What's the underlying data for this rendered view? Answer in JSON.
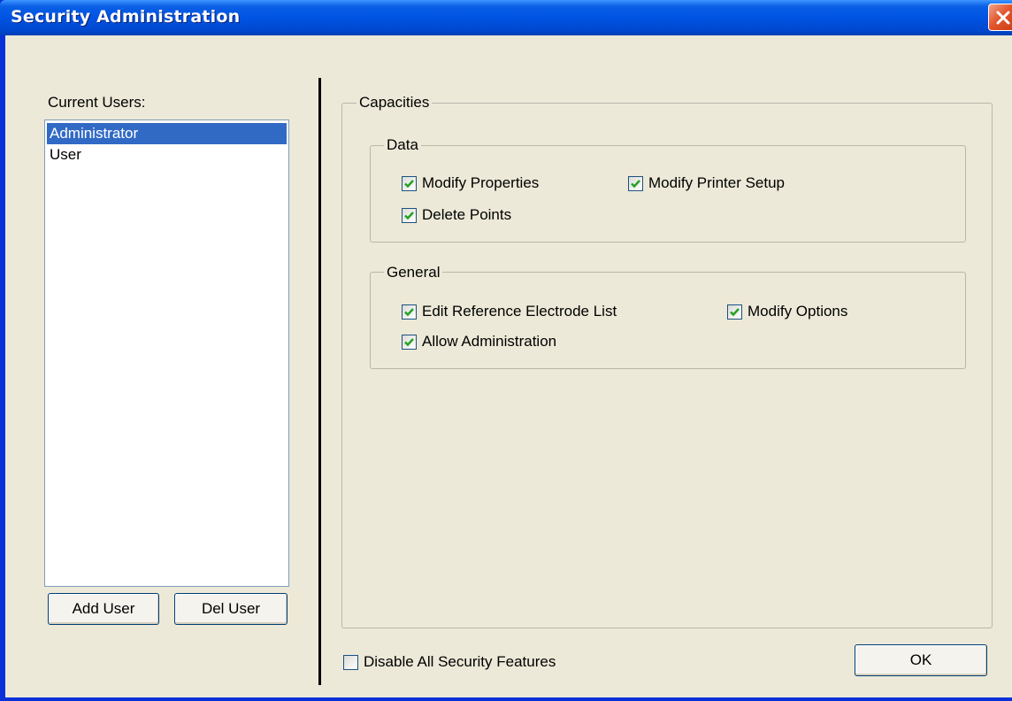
{
  "window": {
    "title": "Security Administration"
  },
  "users": {
    "label": "Current Users:",
    "items": [
      {
        "name": "Administrator",
        "selected": true
      },
      {
        "name": "User",
        "selected": false
      }
    ],
    "add_button": "Add User",
    "del_button": "Del User"
  },
  "capacities": {
    "title": "Capacities",
    "data_group": {
      "title": "Data",
      "items": [
        {
          "label": "Modify Properties",
          "checked": true
        },
        {
          "label": "Modify Printer Setup",
          "checked": true
        },
        {
          "label": "Delete Points",
          "checked": true
        }
      ]
    },
    "general_group": {
      "title": "General",
      "items": [
        {
          "label": "Edit Reference Electrode List",
          "checked": true
        },
        {
          "label": "Modify Options",
          "checked": true
        },
        {
          "label": "Allow Administration",
          "checked": true
        }
      ]
    }
  },
  "footer": {
    "disable_label": "Disable All Security Features",
    "disable_checked": false,
    "ok_button": "OK"
  },
  "colors": {
    "titlebar": "#0054e3",
    "selection": "#316ac5",
    "check": "#21a121",
    "dialog_bg": "#ece9d8"
  }
}
